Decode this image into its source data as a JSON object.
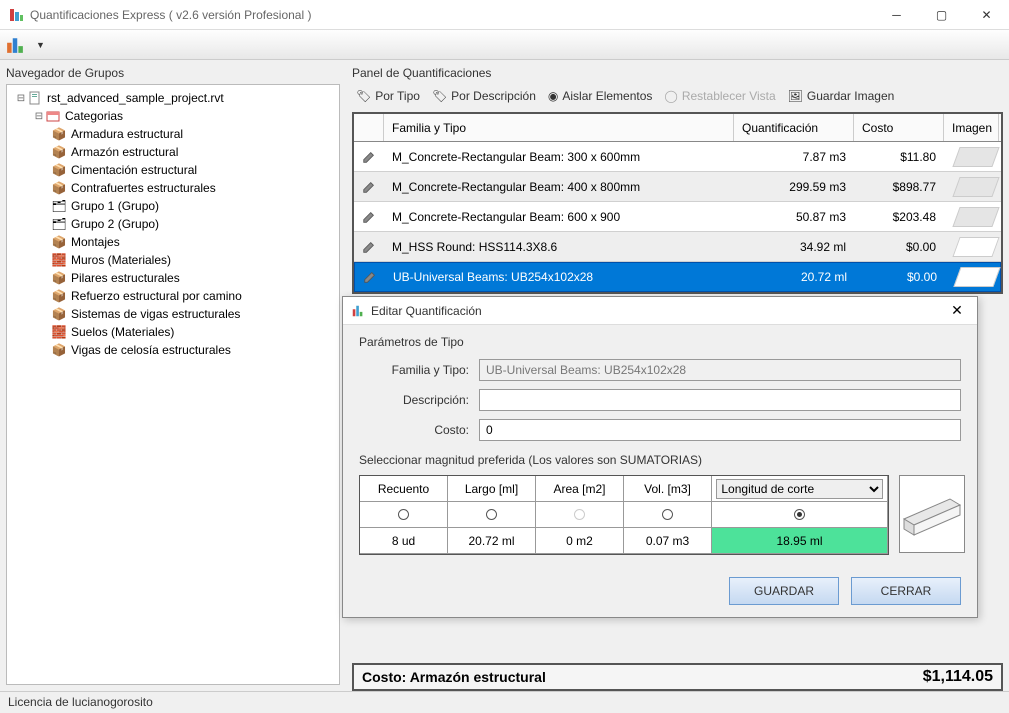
{
  "window": {
    "title": "Quantificaciones Express ( v2.6 versión Profesional )"
  },
  "nav": {
    "title": "Navegador de Grupos",
    "root": "rst_advanced_sample_project.rvt",
    "categories": "Categorias",
    "items": [
      "Armadura estructural",
      "Armazón estructural",
      "Cimentación estructural",
      "Contrafuertes estructurales",
      "Grupo 1 (Grupo)",
      "Grupo 2 (Grupo)",
      "Montajes",
      "Muros (Materiales)",
      "Pilares estructurales",
      "Refuerzo estructural  por camino",
      "Sistemas de vigas estructurales",
      "Suelos (Materiales)",
      "Vigas de celosía estructurales"
    ]
  },
  "panel": {
    "title": "Panel de Quantificaciones",
    "tb": {
      "por_tipo": "Por Tipo",
      "por_desc": "Por Descripción",
      "aislar": "Aislar Elementos",
      "restablecer": "Restablecer Vista",
      "guardar_img": "Guardar Imagen"
    },
    "headers": {
      "fam": "Familia y Tipo",
      "qty": "Quantificación",
      "cost": "Costo",
      "img": "Imagen"
    },
    "rows": [
      {
        "fam": "M_Concrete-Rectangular Beam: 300 x 600mm",
        "qty": "7.87 m3",
        "cost": "$11.80"
      },
      {
        "fam": "M_Concrete-Rectangular Beam: 400 x 800mm",
        "qty": "299.59 m3",
        "cost": "$898.77"
      },
      {
        "fam": "M_Concrete-Rectangular Beam: 600 x 900",
        "qty": "50.87 m3",
        "cost": "$203.48"
      },
      {
        "fam": "M_HSS Round: HSS114.3X8.6",
        "qty": "34.92 ml",
        "cost": "$0.00"
      },
      {
        "fam": "UB-Universal Beams: UB254x102x28",
        "qty": "20.72 ml",
        "cost": "$0.00"
      }
    ]
  },
  "dialog": {
    "title": "Editar Quantificación",
    "section": "Parámetros de Tipo",
    "labels": {
      "fam": "Familia y Tipo:",
      "desc": "Descripción:",
      "cost": "Costo:"
    },
    "values": {
      "fam": "UB-Universal Beams: UB254x102x28",
      "desc": "",
      "cost": "0"
    },
    "mag_label": "Seleccionar magnitud preferida (Los valores son SUMATORIAS)",
    "mag_headers": {
      "rec": "Recuento",
      "largo": "Largo [ml]",
      "area": "Area [m2]",
      "vol": "Vol. [m3]",
      "drop": "Longitud de corte"
    },
    "mag_values": {
      "rec": "8 ud",
      "largo": "20.72 ml",
      "area": "0 m2",
      "vol": "0.07 m3",
      "drop": "18.95 ml"
    },
    "buttons": {
      "save": "GUARDAR",
      "close": "CERRAR"
    }
  },
  "total": {
    "label": "Costo: Armazón estructural",
    "value": "$1,114.05"
  },
  "status": "Licencia de lucianogorosito"
}
